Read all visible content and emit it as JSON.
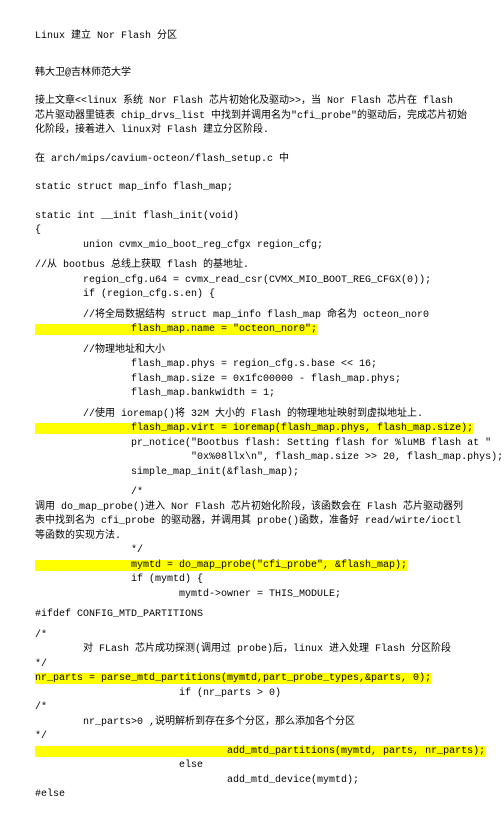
{
  "title": "Linux 建立 Nor Flash 分区",
  "author": "韩大卫@吉林师范大学",
  "intro": "接上文章<<linux 系统 Nor Flash 芯片初始化及驱动>>，当 Nor Flash 芯片在 flash 芯片驱动器里链表 chip_drvs_list 中找到并调用名为\"cfi_probe\"的驱动后，完成芯片初始化阶段，接着进入 linux对 Flash 建立分区阶段.",
  "loc": "在 arch/mips/cavium-octeon/flash_setup.c 中",
  "decl": "static struct map_info flash_map;",
  "fn_sig_l1": "static int __init flash_init(void)",
  "fn_sig_l2": "{",
  "region_decl": "        union cvmx_mio_boot_reg_cfgx region_cfg;",
  "c1": "//从 bootbus 总线上获取 flash 的基地址.",
  "c1_l1": "        region_cfg.u64 = cvmx_read_csr(CVMX_MIO_BOOT_REG_CFGX(0));",
  "c1_l2": "        if (region_cfg.s.en) {",
  "c2": "        //将全局数据结构 struct map_info flash_map 命名为 octeon_nor0",
  "hl1": "                flash_map.name = \"octeon_nor0\";",
  "c3": "        //物理地址和大小",
  "c3_l1": "                flash_map.phys = region_cfg.s.base << 16;",
  "c3_l2": "                flash_map.size = 0x1fc00000 - flash_map.phys;",
  "c3_l3": "                flash_map.bankwidth = 1;",
  "c4": "        //使用 ioremap()将 32M 大小的 Flash 的物理地址映射到虚拟地址上.",
  "hl2": "                flash_map.virt = ioremap(flash_map.phys, flash_map.size);",
  "c4_l2": "                pr_notice(\"Bootbus flash: Setting flash for %luMB flash at \"",
  "c4_l3": "                          \"0x%08llx\\n\", flash_map.size >> 20, flash_map.phys);",
  "c4_l4": "                simple_map_init(&flash_map);",
  "c5a": "                /*",
  "c5": "        调用 do_map_probe()进入 Nor Flash 芯片初始化阶段，该函数会在 Flash 芯片驱动器列表中找到名为 cfi_probe 的驱动器，并调用其 probe()函数，准备好 read/wirte/ioctl 等函数的实现方法.",
  "c5b": "                */",
  "hl3": "                mymtd = do_map_probe(\"cfi_probe\", &flash_map);",
  "c5_l2": "                if (mymtd) {",
  "c5_l3": "                        mymtd->owner = THIS_MODULE;",
  "ifdef": "#ifdef CONFIG_MTD_PARTITIONS",
  "c6a": "/*",
  "c6": "        对 FLash 芯片成功探测(调用过 probe)后，linux 进入处理 Flash 分区阶段",
  "c6b": "*/",
  "hl4": "nr_parts = parse_mtd_partitions(mymtd,part_probe_types,&parts, 0);",
  "c6_l2": "                        if (nr_parts > 0)",
  "c7a": "/*",
  "c7": "        nr_parts>0 ,说明解析到存在多个分区，那么添加各个分区",
  "c7b": "*/",
  "hl5": "                                add_mtd_partitions(mymtd, parts, nr_parts);",
  "c7_l2": "                        else",
  "c7_l3": "                                add_mtd_device(mymtd);",
  "else": "#else"
}
